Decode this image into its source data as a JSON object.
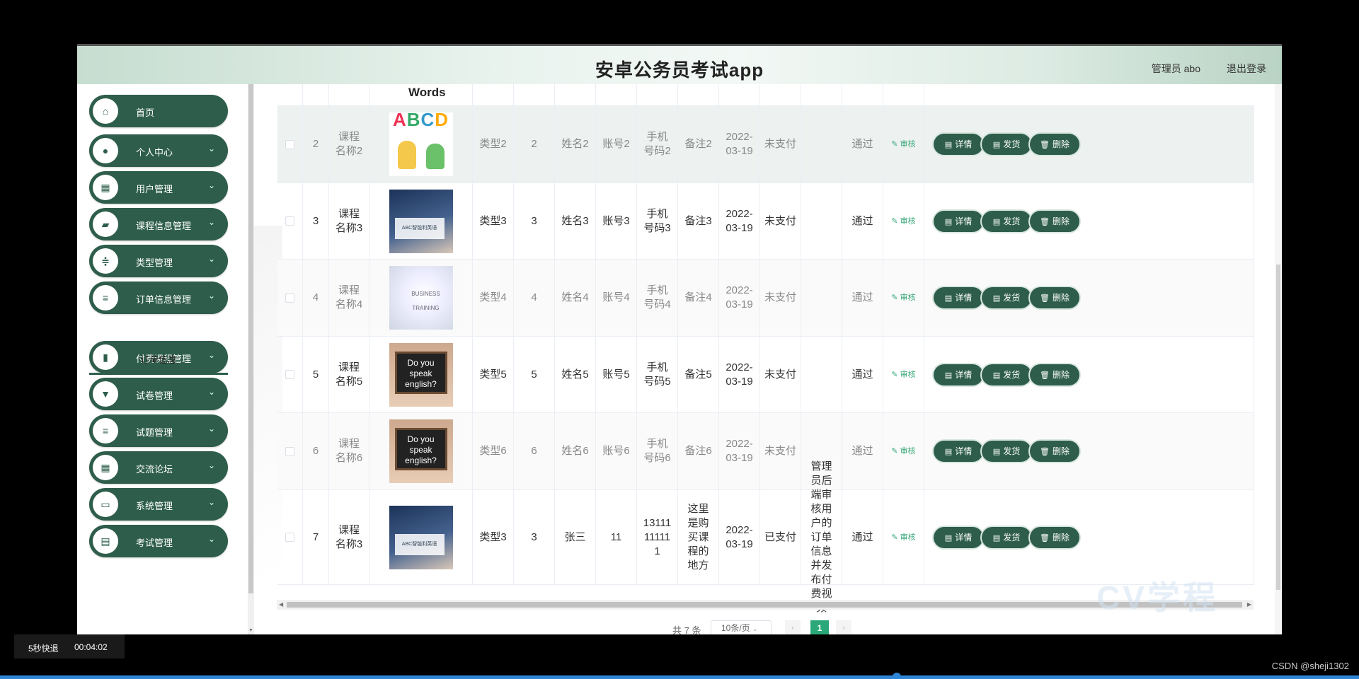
{
  "header": {
    "title": "安卓公务员考试app",
    "user": "管理员 abo",
    "logout": "退出登录"
  },
  "sidebar": {
    "items": [
      {
        "label": "首页",
        "icon": "home-icon"
      },
      {
        "label": "个人中心",
        "icon": "person-icon"
      },
      {
        "label": "用户管理",
        "icon": "grid-icon"
      },
      {
        "label": "课程信息管理",
        "icon": "tag-icon"
      },
      {
        "label": "类型管理",
        "icon": "sliders-icon"
      },
      {
        "label": "订单信息管理",
        "icon": "list-icon"
      },
      {
        "label": "付费课程管理",
        "icon": "chart-icon"
      },
      {
        "label": "试卷管理",
        "icon": "pin-icon"
      },
      {
        "label": "试题管理",
        "icon": "list-icon"
      },
      {
        "label": "交流论坛",
        "icon": "grid-icon"
      },
      {
        "label": "系统管理",
        "icon": "chat-icon"
      },
      {
        "label": "考试管理",
        "icon": "doc-icon"
      }
    ],
    "submenu": "订单信息"
  },
  "table": {
    "partial_top_image_text": "Words",
    "rows": [
      {
        "idx": "2",
        "course": "课程名称2",
        "type": "类型2",
        "qty": "2",
        "name": "姓名2",
        "account": "账号2",
        "phone": "手机号码2",
        "note": "备注2",
        "date": "2022-03-19",
        "pay": "未支付",
        "reply": "",
        "status": "通过",
        "image": "abcd"
      },
      {
        "idx": "3",
        "course": "课程名称3",
        "type": "类型3",
        "qty": "3",
        "name": "姓名3",
        "account": "账号3",
        "phone": "手机号码3",
        "note": "备注3",
        "date": "2022-03-19",
        "pay": "未支付",
        "reply": "",
        "status": "通过",
        "image": "book"
      },
      {
        "idx": "4",
        "course": "课程名称4",
        "type": "类型4",
        "qty": "4",
        "name": "姓名4",
        "account": "账号4",
        "phone": "手机号码4",
        "note": "备注4",
        "date": "2022-03-19",
        "pay": "未支付",
        "reply": "",
        "status": "通过",
        "image": "business"
      },
      {
        "idx": "5",
        "course": "课程名称5",
        "type": "类型5",
        "qty": "5",
        "name": "姓名5",
        "account": "账号5",
        "phone": "手机号码5",
        "note": "备注5",
        "date": "2022-03-19",
        "pay": "未支付",
        "reply": "",
        "status": "通过",
        "image": "english"
      },
      {
        "idx": "6",
        "course": "课程名称6",
        "type": "类型6",
        "qty": "6",
        "name": "姓名6",
        "account": "账号6",
        "phone": "手机号码6",
        "note": "备注6",
        "date": "2022-03-19",
        "pay": "未支付",
        "reply": "",
        "status": "通过",
        "image": "english"
      },
      {
        "idx": "7",
        "course": "课程名称3",
        "type": "类型3",
        "qty": "3",
        "name": "张三",
        "account": "11",
        "phone": "13111111111",
        "note": "这里是购买课程的地方",
        "date": "2022-03-19",
        "pay": "已支付",
        "reply": "管理员后端审核用户的订单信息并发布付费视频",
        "status": "通过",
        "image": "book"
      }
    ],
    "audit_label": "审核",
    "btn_detail": "详情",
    "btn_ship": "发货",
    "btn_delete": "删除",
    "book_text": "ABC智能利英语",
    "business_text": "BUSINESS TRAINING",
    "english_text": "Do you speak english?"
  },
  "pager": {
    "total": "共 7 条",
    "size": "10条/页",
    "current": "1",
    "prev": "‹",
    "next": "›"
  },
  "watermark": "CV学程",
  "video": {
    "rewind": "5秒快退",
    "time": "00:04:02",
    "progress": 0.66
  },
  "credit": "CSDN @sheji1302",
  "colors": {
    "accent": "#2e5e4b",
    "active_page": "#2aa879",
    "audit": "#3aa87a"
  }
}
